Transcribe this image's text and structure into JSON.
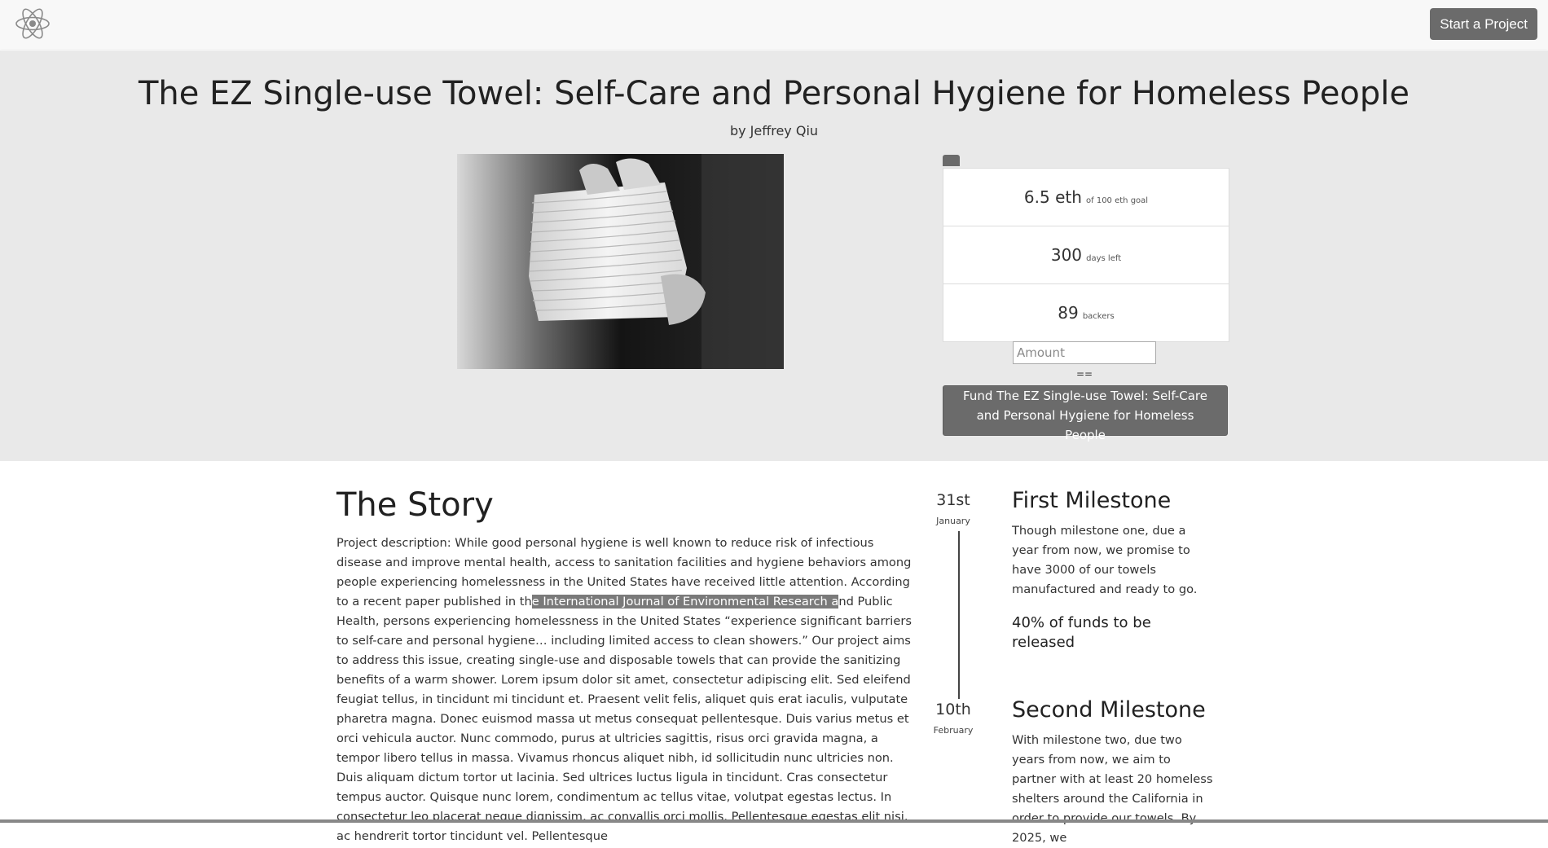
{
  "navbar": {
    "logo_icon": "atom-icon",
    "start_button": "Start a Project"
  },
  "hero": {
    "title": "The EZ Single-use Towel: Self-Care and Personal Hygiene for Homeless People",
    "byline": "by Jeffrey Qiu",
    "image": "towel-stack-photo",
    "stats": {
      "raised_value": "6.5 eth",
      "raised_label": "of 100 eth goal",
      "days_value": "300",
      "days_label": "days left",
      "backers_value": "89",
      "backers_label": "backers"
    },
    "amount_placeholder": "Amount",
    "conversion": "==",
    "fund_button": "Fund The EZ Single-use Towel: Self-Care and Personal Hygiene for Homeless People"
  },
  "story": {
    "title": "The Story",
    "text_before": "Project description: While good personal hygiene is well known to reduce risk of infectious disease and improve mental health, access to sanitation facilities and hygiene behaviors among people experiencing homelessness in the United States have received little attention. According to a recent paper published in th",
    "text_highlight": "e International Journal of Environmental Research a",
    "text_after": "nd Public Health, persons experiencing homelessness in the United States “experience significant barriers to self-care and personal hygiene… including limited access to clean showers.” Our project aims to address this issue, creating single-use and disposable towels that can provide the sanitizing benefits of a warm shower. Lorem ipsum dolor sit amet, consectetur adipiscing elit. Sed eleifend feugiat tellus, in tincidunt mi tincidunt et. Praesent velit felis, aliquet quis erat iaculis, vulputate pharetra magna. Donec euismod massa ut metus consequat pellentesque. Duis varius metus et orci vehicula auctor. Nunc commodo, purus at ultricies sagittis, risus orci gravida magna, a tempor libero tellus in massa. Vivamus rhoncus aliquet nibh, id sollicitudin nunc ultricies non. Duis aliquam dictum tortor ut lacinia. Sed ultrices luctus ligula in tincidunt. Cras consectetur tempus auctor. Quisque nunc lorem, condimentum ac tellus vitae, volutpat egestas lectus. In consectetur leo placerat neque dignissim, ac convallis orci mollis. Pellentesque egestas elit nisi, ac hendrerit tortor tincidunt vel. Pellentesque"
  },
  "milestones": [
    {
      "day": "31st",
      "month": "January",
      "title": "First Milestone",
      "text": "Though milestone one, due a year from now, we promise to have 3000 of our towels manufactured and ready to go.",
      "release": "40% of funds to be released"
    },
    {
      "day": "10th",
      "month": "February",
      "title": "Second Milestone",
      "text": "With milestone two, due two years from now, we aim to partner with at least 20 homeless shelters around the California in order to provide our towels. By 2025, we"
    }
  ]
}
